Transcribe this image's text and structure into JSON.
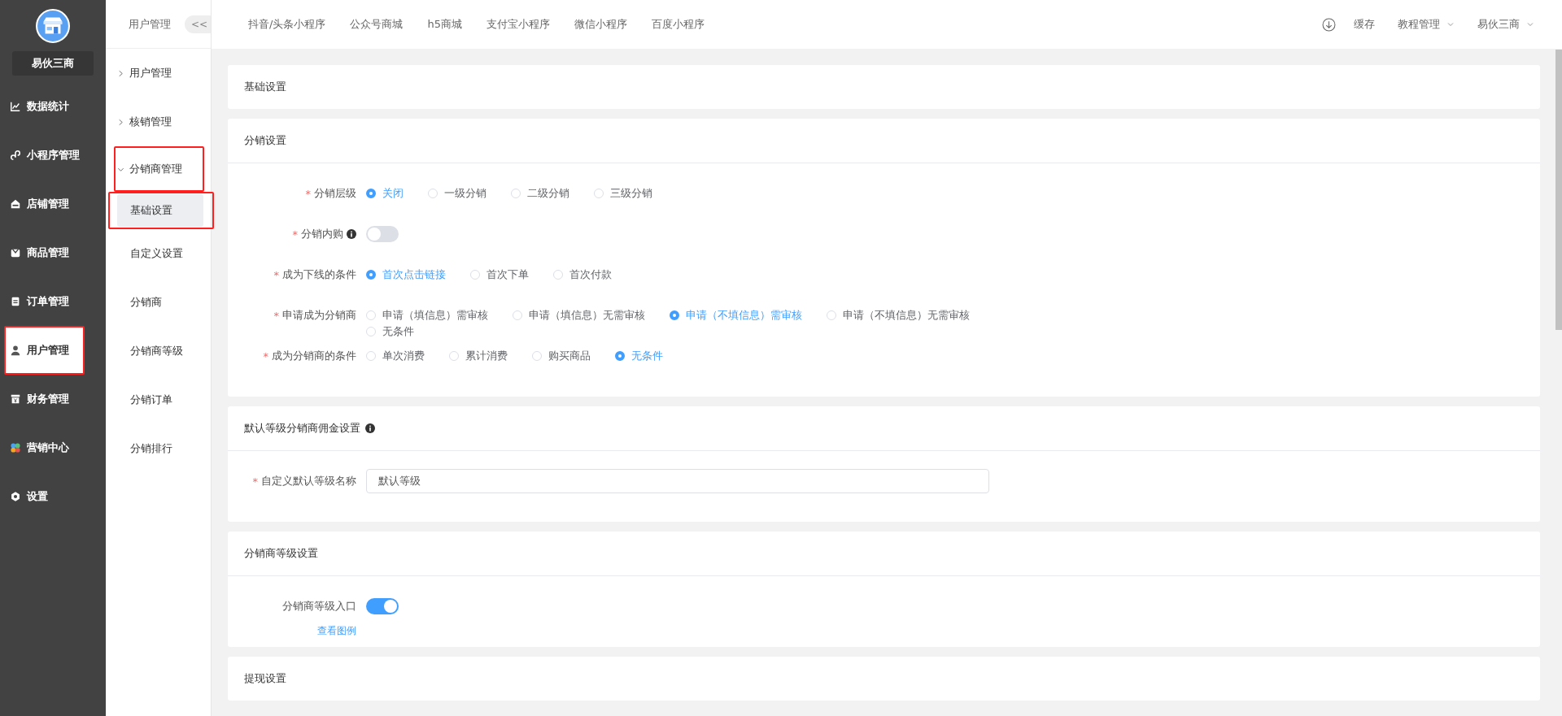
{
  "sidebar": {
    "store_name": "易伙三商",
    "items": [
      {
        "label": "数据统计",
        "selected": false,
        "highlighted": false
      },
      {
        "label": "小程序管理",
        "selected": false,
        "highlighted": false
      },
      {
        "label": "店铺管理",
        "selected": false,
        "highlighted": false
      },
      {
        "label": "商品管理",
        "selected": false,
        "highlighted": false
      },
      {
        "label": "订单管理",
        "selected": false,
        "highlighted": false
      },
      {
        "label": "用户管理",
        "selected": true,
        "highlighted": true
      },
      {
        "label": "财务管理",
        "selected": false,
        "highlighted": false
      },
      {
        "label": "营销中心",
        "selected": false,
        "highlighted": false
      },
      {
        "label": "设置",
        "selected": false,
        "highlighted": false
      }
    ]
  },
  "submenu": {
    "title": "用户管理",
    "collapse_button": "<<",
    "groups": [
      {
        "label": "用户管理",
        "expanded": false,
        "highlighted": false
      },
      {
        "label": "核销管理",
        "expanded": false,
        "highlighted": false
      },
      {
        "label": "分销商管理",
        "expanded": true,
        "highlighted": true,
        "children": [
          {
            "label": "基础设置",
            "selected": true,
            "highlighted": true
          },
          {
            "label": "自定义设置",
            "selected": false,
            "highlighted": false
          },
          {
            "label": "分销商",
            "selected": false,
            "highlighted": false
          },
          {
            "label": "分销商等级",
            "selected": false,
            "highlighted": false
          },
          {
            "label": "分销订单",
            "selected": false,
            "highlighted": false
          },
          {
            "label": "分销排行",
            "selected": false,
            "highlighted": false
          }
        ]
      }
    ]
  },
  "top_nav": {
    "tabs": [
      "抖音/头条小程序",
      "公众号商城",
      "h5商城",
      "支付宝小程序",
      "微信小程序",
      "百度小程序"
    ],
    "cache": "缓存",
    "tutorial": "教程管理",
    "user": "易伙三商"
  },
  "required_mark": "*",
  "sections": [
    {
      "title": "基础设置"
    },
    {
      "title": "分销设置",
      "fields": [
        {
          "kind": "radio",
          "label": "分销层级",
          "required": true,
          "options": [
            {
              "label": "关闭",
              "selected": true
            },
            {
              "label": "一级分销",
              "selected": false
            },
            {
              "label": "二级分销",
              "selected": false
            },
            {
              "label": "三级分销",
              "selected": false
            }
          ]
        },
        {
          "kind": "switch",
          "label": "分销内购",
          "required": true,
          "info": true,
          "on": false
        },
        {
          "kind": "radio",
          "label": "成为下线的条件",
          "required": true,
          "options": [
            {
              "label": "首次点击链接",
              "selected": true
            },
            {
              "label": "首次下单",
              "selected": false
            },
            {
              "label": "首次付款",
              "selected": false
            }
          ]
        },
        {
          "kind": "radio",
          "label": "申请成为分销商",
          "required": true,
          "options": [
            {
              "label": "申请（填信息）需审核",
              "selected": false
            },
            {
              "label": "申请（填信息）无需审核",
              "selected": false
            },
            {
              "label": "申请（不填信息）需审核",
              "selected": true
            },
            {
              "label": "申请（不填信息）无需审核",
              "selected": false
            },
            {
              "label": "无条件",
              "selected": false
            }
          ]
        },
        {
          "kind": "radio",
          "label": "成为分销商的条件",
          "required": true,
          "options": [
            {
              "label": "单次消费",
              "selected": false
            },
            {
              "label": "累计消费",
              "selected": false
            },
            {
              "label": "购买商品",
              "selected": false
            },
            {
              "label": "无条件",
              "selected": true
            }
          ]
        }
      ]
    },
    {
      "title": "默认等级分销商佣金设置",
      "info": true,
      "fields": [
        {
          "kind": "input",
          "label": "自定义默认等级名称",
          "required": true,
          "value": "默认等级"
        }
      ]
    },
    {
      "title": "分销商等级设置",
      "fields": [
        {
          "kind": "switch",
          "label": "分销商等级入口",
          "on": true,
          "link": "查看图例"
        }
      ]
    },
    {
      "title": "提现设置"
    }
  ]
}
